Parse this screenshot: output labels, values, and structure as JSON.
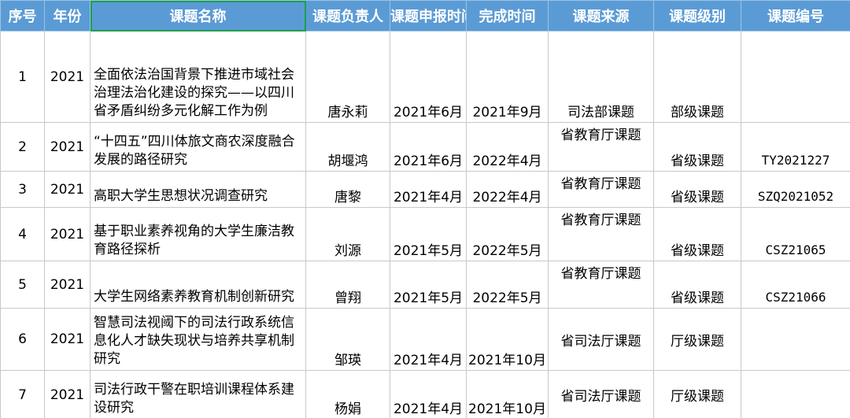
{
  "headers": {
    "seq": "序号",
    "year": "年份",
    "name": "课题名称",
    "leader": "课题负责人",
    "apply_time": "课题申报时间",
    "finish_time": "完成时间",
    "source": "课题来源",
    "level": "课题级别",
    "code": "课题编号"
  },
  "rows": [
    {
      "seq": "1",
      "year": "2021",
      "name": "全面依法治国背景下推进市域社会治理法治化建设的探究——以四川省矛盾纠纷多元化解工作为例",
      "leader": "唐永莉",
      "apply": "2021年6月",
      "finish": "2021年9月",
      "source": "司法部课题",
      "level": "部级课题",
      "code": ""
    },
    {
      "seq": "2",
      "year": "2021",
      "name": "“十四五”四川体旅文商农深度融合发展的路径研究",
      "leader": "胡堰鸿",
      "apply": "2021年6月",
      "finish": "2022年4月",
      "source": "省教育厅课题",
      "level": "省级课题",
      "code": "TY2021227"
    },
    {
      "seq": "3",
      "year": "2021",
      "name": "高职大学生思想状况调查研究",
      "leader": "唐黎",
      "apply": "2021年4月",
      "finish": "2022年4月",
      "source": "省教育厅课题",
      "level": "省级课题",
      "code": "SZQ2021052"
    },
    {
      "seq": "4",
      "year": "2021",
      "name": "基于职业素养视角的大学生廉洁教育路径探析",
      "leader": "刘源",
      "apply": "2021年5月",
      "finish": "2022年5月",
      "source": "省教育厅课题",
      "level": "省级课题",
      "code": "CSZ21065"
    },
    {
      "seq": "5",
      "year": "2021",
      "name": "大学生网络素养教育机制创新研究",
      "leader": "曾翔",
      "apply": "2021年5月",
      "finish": "2022年5月",
      "source": "省教育厅课题",
      "level": "省级课题",
      "code": "CSZ21066"
    },
    {
      "seq": "6",
      "year": "2021",
      "name": "智慧司法视阈下的司法行政系统信息化人才缺失现状与培养共享机制研究",
      "leader": "邹瑛",
      "apply": "2021年4月",
      "finish": "2021年10月",
      "source": "省司法厅课题",
      "level": "厅级课题",
      "code": ""
    },
    {
      "seq": "7",
      "year": "2021",
      "name": "司法行政干警在职培训课程体系建设研究",
      "leader": "杨娟",
      "apply": "2021年4月",
      "finish": "2021年10月",
      "source": "省司法厅课题",
      "level": "厅级课题",
      "code": ""
    }
  ]
}
